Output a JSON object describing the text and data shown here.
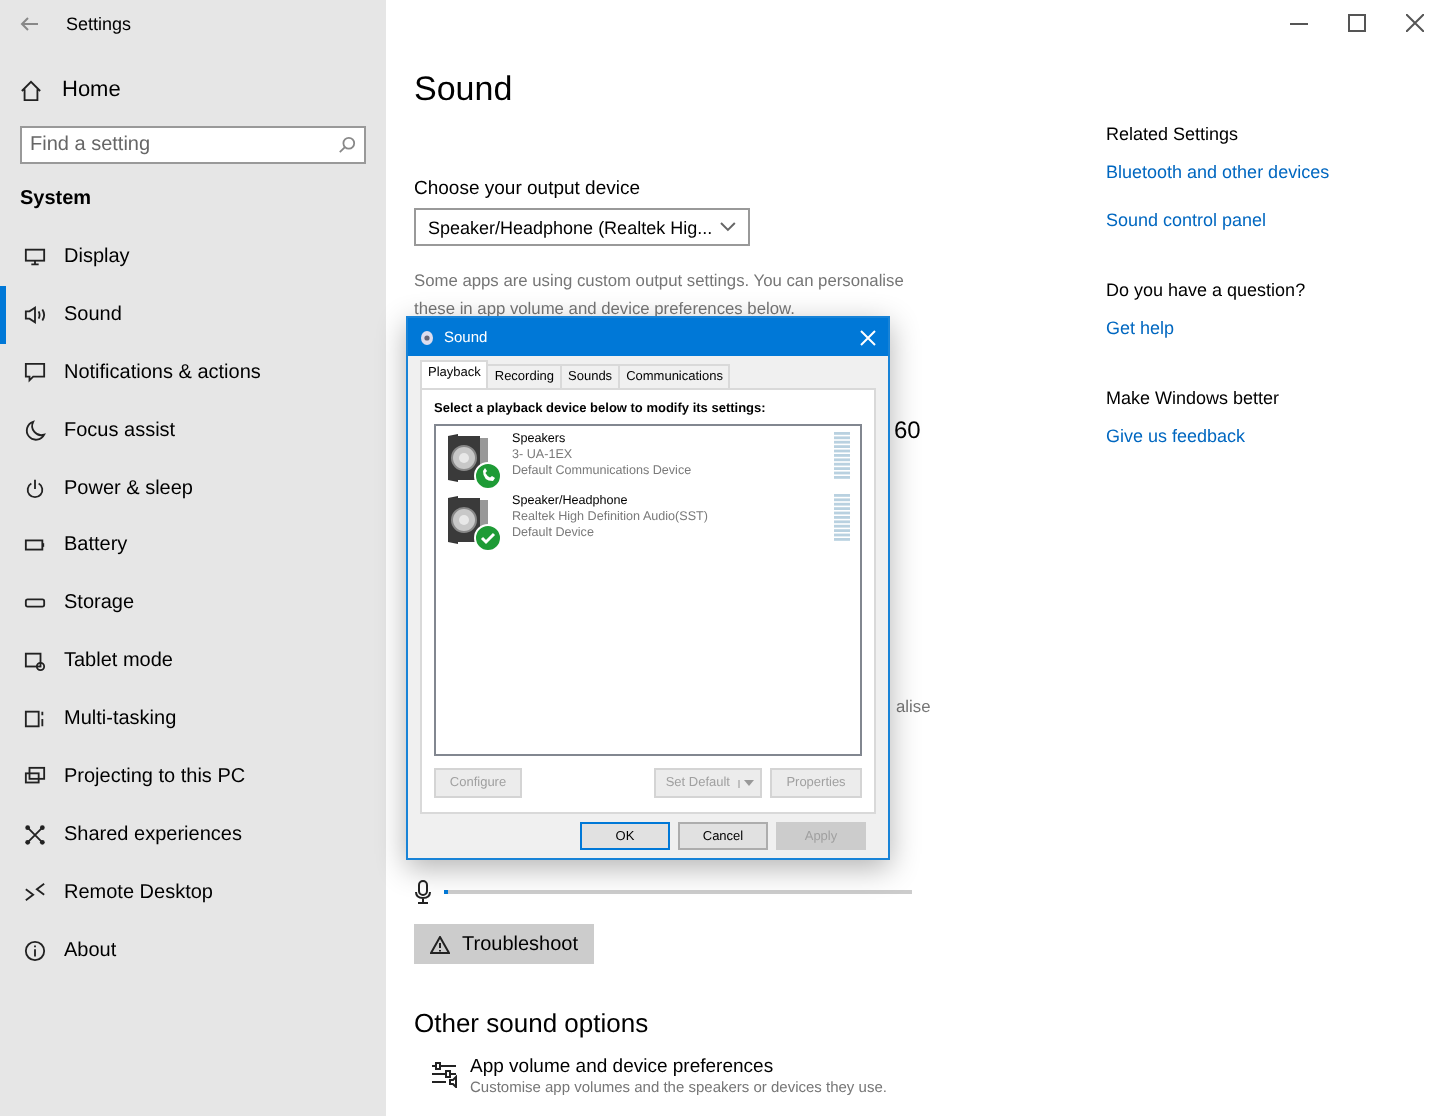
{
  "window": {
    "title": "Settings"
  },
  "sidebar": {
    "home": "Home",
    "search": {
      "placeholder": "Find a setting"
    },
    "section": "System",
    "items": [
      {
        "label": "Display",
        "selected": false
      },
      {
        "label": "Sound",
        "selected": true
      },
      {
        "label": "Notifications & actions",
        "selected": false
      },
      {
        "label": "Focus assist",
        "selected": false
      },
      {
        "label": "Power & sleep",
        "selected": false
      },
      {
        "label": "Battery",
        "selected": false
      },
      {
        "label": "Storage",
        "selected": false
      },
      {
        "label": "Tablet mode",
        "selected": false
      },
      {
        "label": "Multi-tasking",
        "selected": false
      },
      {
        "label": "Projecting to this PC",
        "selected": false
      },
      {
        "label": "Shared experiences",
        "selected": false
      },
      {
        "label": "Remote Desktop",
        "selected": false
      },
      {
        "label": "About",
        "selected": false
      }
    ]
  },
  "main": {
    "title": "Sound",
    "output_label": "Choose your output device",
    "output_device": "Speaker/Headphone (Realtek Hig...",
    "note": "Some apps are using custom output settings. You can personalise these in app volume and device preferences below.",
    "covered_fragments": [
      "60",
      "alise"
    ],
    "input_meter": {
      "level": 0.01
    },
    "troubleshoot": "Troubleshoot",
    "other_title": "Other sound options",
    "app_volume": {
      "title": "App volume and device preferences",
      "description": "Customise app volumes and the speakers or devices they use."
    }
  },
  "related": [
    {
      "heading": "Related Settings",
      "links": [
        "Bluetooth and other devices",
        "Sound control panel"
      ]
    },
    {
      "heading": "Do you have a question?",
      "links": [
        "Get help"
      ]
    },
    {
      "heading": "Make Windows better",
      "links": [
        "Give us feedback"
      ]
    }
  ],
  "dialog": {
    "title": "Sound",
    "tabs": [
      {
        "label": "Playback",
        "selected": true
      },
      {
        "label": "Recording",
        "selected": false
      },
      {
        "label": "Sounds",
        "selected": false
      },
      {
        "label": "Communications",
        "selected": false
      }
    ],
    "instruction": "Select a playback device below to modify its settings:",
    "devices": [
      {
        "name": "Speakers",
        "detail": "3- UA-1EX",
        "status": "Default Communications Device",
        "kind": "communications"
      },
      {
        "name": "Speaker/Headphone",
        "detail": "Realtek High Definition Audio(SST)",
        "status": "Default Device",
        "kind": "default"
      }
    ],
    "device_buttons": [
      {
        "label": "Configure",
        "disabled": true,
        "kind": "plain"
      },
      {
        "label": "Set Default",
        "disabled": true,
        "kind": "split"
      },
      {
        "label": "Properties",
        "disabled": true,
        "kind": "plain"
      }
    ],
    "footer_buttons": [
      {
        "label": "OK",
        "disabled": false,
        "default": true
      },
      {
        "label": "Cancel",
        "disabled": false,
        "default": false
      },
      {
        "label": "Apply",
        "disabled": true,
        "default": false
      }
    ]
  }
}
